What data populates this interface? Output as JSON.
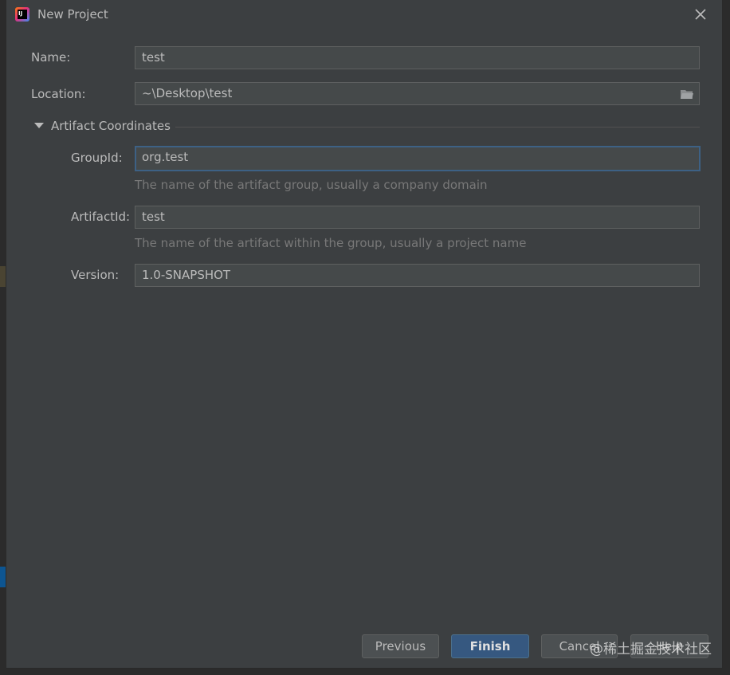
{
  "dialog": {
    "title": "New Project",
    "app_icon": "intellij-idea-icon",
    "close_icon": "close-icon"
  },
  "form": {
    "name_label": "Name:",
    "name_value": "test",
    "location_label": "Location:",
    "location_value": "~\\Desktop\\test",
    "location_browse_icon": "folder-icon"
  },
  "artifact": {
    "section_label": "Artifact Coordinates",
    "expanded": true,
    "group_label": "GroupId:",
    "group_value": "org.test",
    "group_hint": "The name of the artifact group, usually a company domain",
    "artifact_label": "ArtifactId:",
    "artifact_value": "test",
    "artifact_hint": "The name of the artifact within the group, usually a project name",
    "version_label": "Version:",
    "version_value": "1.0-SNAPSHOT"
  },
  "buttons": {
    "previous": "Previous",
    "finish": "Finish",
    "cancel": "Cancel",
    "help": "Help"
  },
  "watermark": "@稀土掘金技术社区",
  "colors": {
    "dialog_bg": "#3c3f41",
    "field_bg": "#45494a",
    "focus_border": "#3d6185",
    "primary_button": "#365880"
  }
}
